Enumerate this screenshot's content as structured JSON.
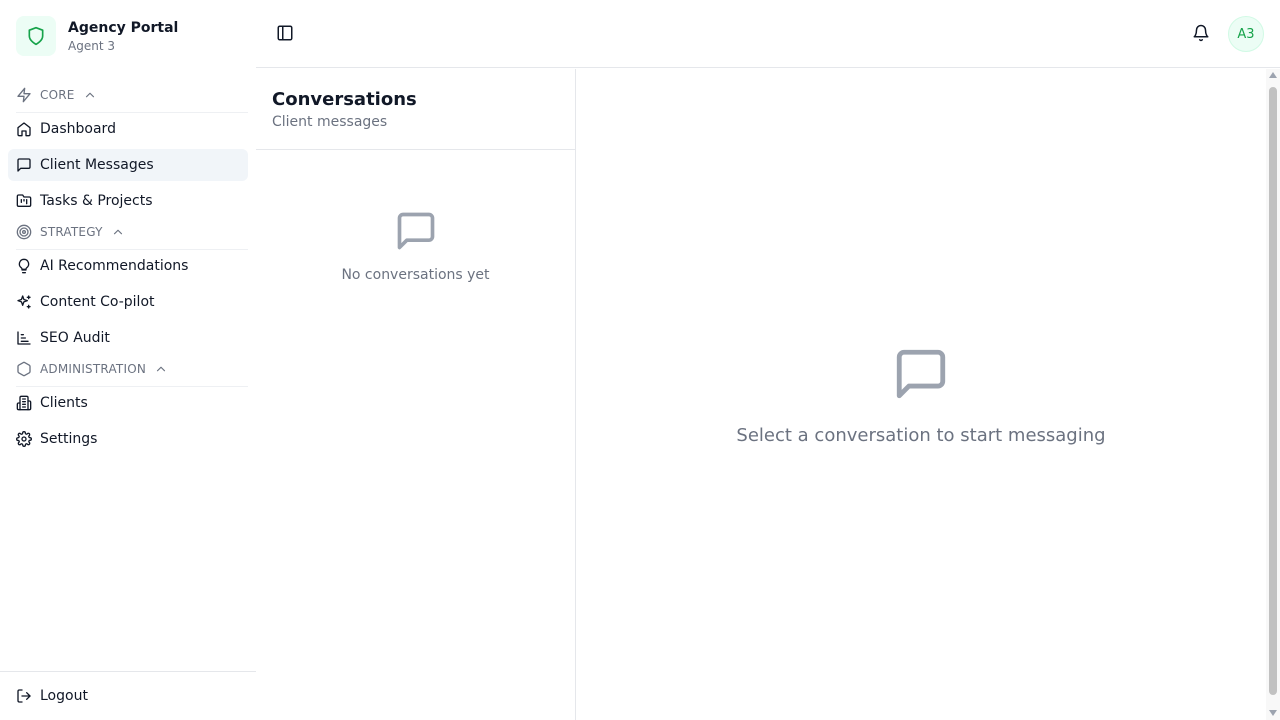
{
  "brand": {
    "title": "Agency Portal",
    "subtitle": "Agent 3",
    "icon": "shield-icon"
  },
  "sections": {
    "core": {
      "label": "CORE",
      "icon": "zap-icon"
    },
    "strategy": {
      "label": "STRATEGY",
      "icon": "target-icon"
    },
    "administration": {
      "label": "ADMINISTRATION",
      "icon": "hexagon-icon"
    }
  },
  "nav": {
    "dashboard": "Dashboard",
    "client_messages": "Client Messages",
    "tasks_projects": "Tasks & Projects",
    "ai_recommendations": "AI Recommendations",
    "content_copilot": "Content Co-pilot",
    "seo_audit": "SEO Audit",
    "clients": "Clients",
    "settings": "Settings",
    "logout": "Logout",
    "active": "client_messages"
  },
  "header": {
    "avatar_initials": "A3"
  },
  "conversations": {
    "title": "Conversations",
    "subtitle": "Client messages",
    "empty_text": "No conversations yet"
  },
  "main": {
    "empty_text": "Select a conversation to start messaging"
  },
  "colors": {
    "accent": "#16a34a",
    "accent_bg": "#ecfdf5",
    "muted": "#6b7280",
    "active_bg": "#f1f5f9",
    "border": "#e5e7eb"
  }
}
